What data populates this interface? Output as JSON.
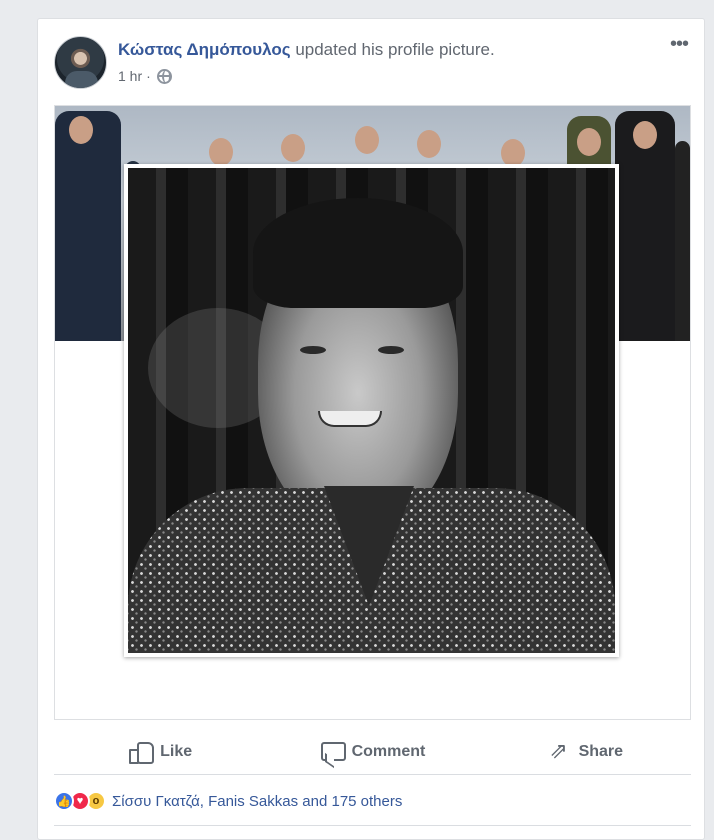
{
  "post": {
    "author": "Κώστας Δημόπουλος",
    "action_text": " updated his profile picture.",
    "timestamp": "1 hr",
    "separator": "·",
    "privacy_icon": "globe-icon",
    "menu_label": "•••"
  },
  "actions": {
    "like_label": "Like",
    "comment_label": "Comment",
    "share_label": "Share",
    "share_glyph": "⇗"
  },
  "reactions": {
    "icons": [
      "like-reaction-icon",
      "love-reaction-icon",
      "wow-reaction-icon"
    ],
    "summary": "Σίσσυ Γκατζά, Fanis Sakkas and 175 others"
  },
  "colors": {
    "brand_link": "#365899",
    "muted": "#606770",
    "page_bg": "#e9ebee"
  }
}
